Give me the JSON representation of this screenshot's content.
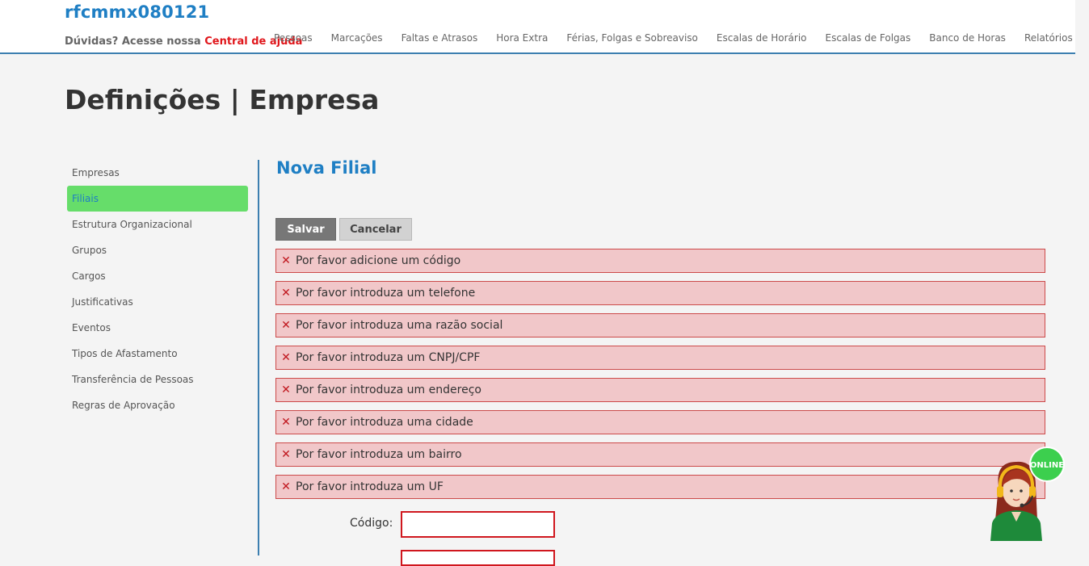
{
  "header": {
    "brand": "rfcmmx080121",
    "help_prefix": "Dúvidas? Acesse nossa",
    "help_link": "Central de ajuda"
  },
  "nav": [
    {
      "label": "Pessoas"
    },
    {
      "label": "Marcações"
    },
    {
      "label": "Faltas e Atrasos"
    },
    {
      "label": "Hora Extra"
    },
    {
      "label": "Férias, Folgas e Sobreaviso"
    },
    {
      "label": "Escalas de Horário"
    },
    {
      "label": "Escalas de Folgas"
    },
    {
      "label": "Banco de Horas"
    },
    {
      "label": "Relatórios"
    }
  ],
  "page": {
    "title": "Definições | Empresa"
  },
  "sidebar": {
    "items": [
      {
        "label": "Empresas"
      },
      {
        "label": "Filiais"
      },
      {
        "label": "Estrutura Organizacional"
      },
      {
        "label": "Grupos"
      },
      {
        "label": "Cargos"
      },
      {
        "label": "Justificativas"
      },
      {
        "label": "Eventos"
      },
      {
        "label": "Tipos de Afastamento"
      },
      {
        "label": "Transferência de Pessoas"
      },
      {
        "label": "Regras de Aprovação"
      }
    ]
  },
  "form": {
    "title": "Nova Filial",
    "save_label": "Salvar",
    "cancel_label": "Cancelar",
    "errors": [
      {
        "text": "Por favor adicione um código"
      },
      {
        "text": "Por favor introduza um telefone"
      },
      {
        "text": "Por favor introduza uma razão social"
      },
      {
        "text": "Por favor introduza um CNPJ/CPF"
      },
      {
        "text": "Por favor introduza um endereço"
      },
      {
        "text": "Por favor introduza uma cidade"
      },
      {
        "text": "Por favor introduza um bairro"
      },
      {
        "text": "Por favor introduza um UF"
      }
    ],
    "codigo_label": "Código:",
    "codigo_value": ""
  },
  "chat_widget": {
    "badge": "ONLINE",
    "icon": "support-agent-icon"
  },
  "colors": {
    "brand_blue": "#1f7fc4",
    "active_green": "#66dd6a",
    "error_bg": "#f1c7c9",
    "error_border": "#cc4a4a",
    "help_red": "#e0161b"
  }
}
